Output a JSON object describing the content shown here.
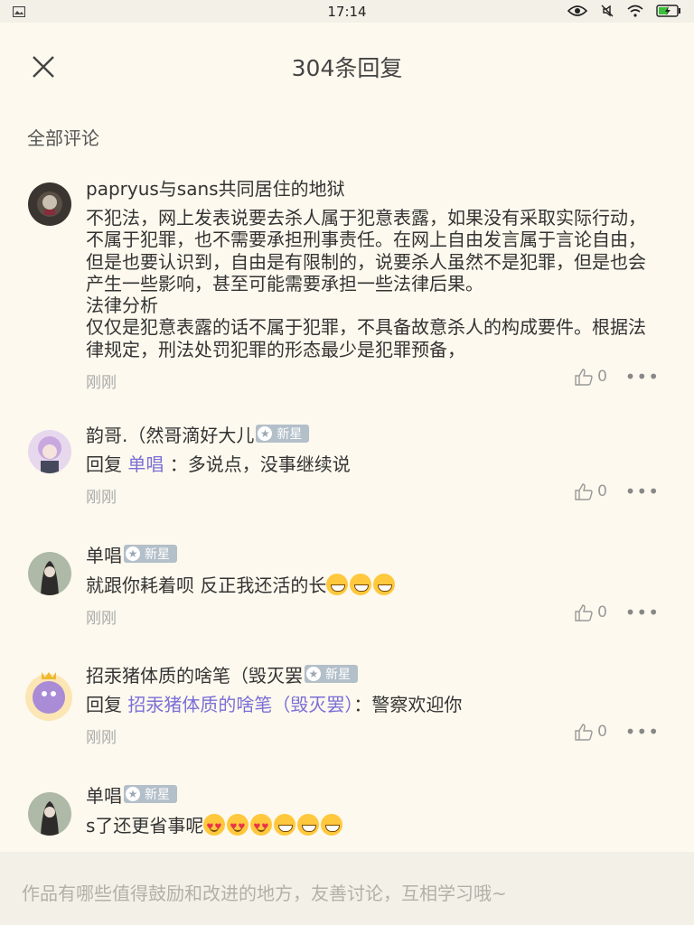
{
  "status_bar": {
    "time": "17:14"
  },
  "header": {
    "title": "304条回复"
  },
  "section": {
    "label": "全部评论"
  },
  "comments": [
    {
      "username": "papryus与sans共同居住的地狱",
      "badge": "",
      "text": "不犯法，网上发表说要去杀人属于犯意表露，如果没有采取实际行动，不属于犯罪，也不需要承担刑事责任。在网上自由发言属于言论自由，但是也要认识到，自由是有限制的，说要杀人虽然不是犯罪，但是也会产生一些影响，甚至可能需要承担一些法律后果。\n法律分析\n仅仅是犯意表露的话不属于犯罪，不具备故意杀人的构成要件。根据法律规定，刑法处罚犯罪的形态最少是犯罪预备，",
      "time": "刚刚",
      "likes": "0"
    },
    {
      "username": "韵哥.（然哥滴好大儿",
      "badge": "新星",
      "reply_prefix": "回复",
      "reply_target": "单唱",
      "reply_text": "：多说点，没事继续说",
      "time": "刚刚",
      "likes": "0"
    },
    {
      "username": "单唱",
      "badge": "新星",
      "text": "就跟你耗着呗 反正我还活的长",
      "time": "刚刚",
      "likes": "0"
    },
    {
      "username": "招汞猪体质的啥笔（毁灭罢",
      "badge": "新星",
      "reply_prefix": "回复",
      "reply_target": "招汞猪体质的啥笔（毁灭罢）",
      "reply_text": "：警察欢迎你",
      "time": "刚刚",
      "likes": "0"
    },
    {
      "username": "单唱",
      "badge": "新星",
      "text": "s了还更省事呢"
    }
  ],
  "input": {
    "placeholder": "作品有哪些值得鼓励和改进的地方，友善讨论，互相学习哦~"
  },
  "icons": {
    "close": "close-icon",
    "like": "thumbs-up-icon",
    "more": "more-dots-icon"
  }
}
